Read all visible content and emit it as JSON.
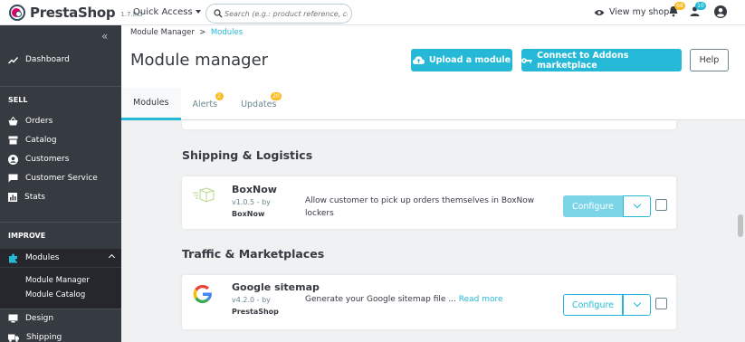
{
  "header": {
    "logo_text": "PrestaShop",
    "version": "1.7.8.3",
    "quick_access": "Quick Access",
    "search_placeholder": "Search (e.g.: product reference, custon",
    "view_shop": "View my shop",
    "orders_badge": "68",
    "customers_badge": "10"
  },
  "sidebar": {
    "dashboard": "Dashboard",
    "sell_section": "SELL",
    "orders": "Orders",
    "catalog": "Catalog",
    "customers": "Customers",
    "customer_service": "Customer Service",
    "stats": "Stats",
    "improve_section": "IMPROVE",
    "modules": "Modules",
    "module_manager": "Module Manager",
    "module_catalog": "Module Catalog",
    "design": "Design",
    "shipping": "Shipping"
  },
  "page": {
    "breadcrumb_parent": "Module Manager",
    "breadcrumb_current": "Modules",
    "title": "Module manager",
    "upload_button": "Upload a module",
    "connect_button": "Connect to Addons marketplace",
    "help_button": "Help",
    "tabs": [
      {
        "label": "Modules",
        "badge": null
      },
      {
        "label": "Alerts",
        "badge": "2"
      },
      {
        "label": "Updates",
        "badge": "20"
      }
    ]
  },
  "categories": [
    {
      "title": "Shipping & Logistics",
      "module": {
        "name": "BoxNow",
        "version": "v1.0.5 - by",
        "author": "BoxNow",
        "desc_line1": "Allow customer to pick up orders themselves in BoxNow",
        "desc_line2": "lockers",
        "configure": "Configure"
      }
    },
    {
      "title": "Traffic & Marketplaces",
      "module": {
        "name": "Google sitemap",
        "version": "v4.2.0 - by",
        "author": "PrestaShop",
        "desc": "Generate your Google sitemap file ...",
        "read_more": "Read more",
        "configure": "Configure"
      }
    }
  ],
  "colors": {
    "primary": "#25b9d7",
    "sidebar_bg": "#363a41",
    "badge": "#fbbb22"
  }
}
